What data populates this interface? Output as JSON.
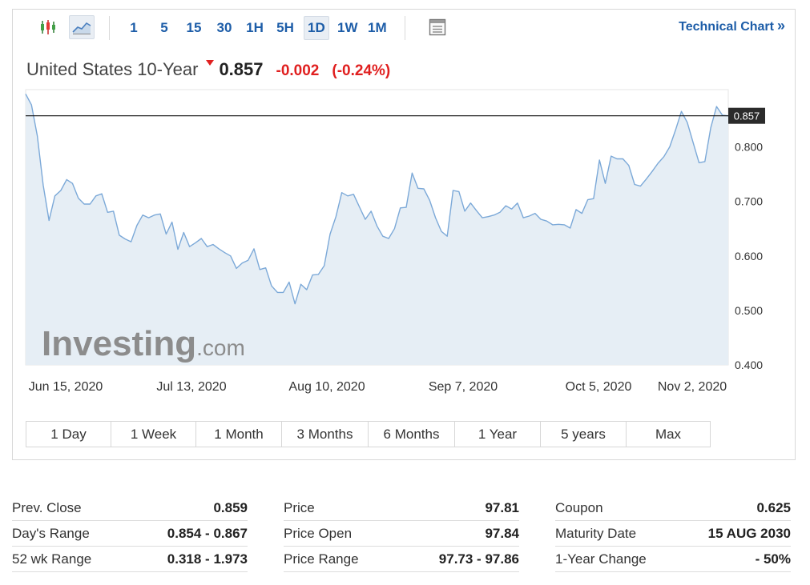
{
  "toolbar": {
    "timeframes": [
      "1",
      "5",
      "15",
      "30",
      "1H",
      "5H",
      "1D",
      "1W",
      "1M"
    ],
    "active_timeframe": "1D",
    "technical_chart_label": "Technical Chart",
    "technical_chart_arrow": "»"
  },
  "instrument": {
    "name": "United States 10-Year",
    "last": "0.857",
    "change": "-0.002",
    "change_pct": "(-0.24%)"
  },
  "watermark": {
    "brand": "Investing",
    "suffix": ".com"
  },
  "chart_data": {
    "type": "area",
    "x_tick_labels": [
      "Jun 15, 2020",
      "Jul 13, 2020",
      "Aug 10, 2020",
      "Sep 7, 2020",
      "Oct 5, 2020",
      "Nov 2, 2020"
    ],
    "y_ticks": [
      0.4,
      0.5,
      0.6,
      0.7,
      0.8
    ],
    "y_tick_labels": [
      "0.400",
      "0.500",
      "0.600",
      "0.700",
      "0.800"
    ],
    "ylim": [
      0.4,
      0.905
    ],
    "current_value_label": "0.857",
    "current_value": 0.857,
    "series": [
      {
        "values": [
          0.897,
          0.877,
          0.82,
          0.73,
          0.665,
          0.71,
          0.72,
          0.74,
          0.733,
          0.706,
          0.695,
          0.695,
          0.71,
          0.714,
          0.68,
          0.682,
          0.638,
          0.631,
          0.626,
          0.656,
          0.675,
          0.67,
          0.675,
          0.677,
          0.64,
          0.662,
          0.612,
          0.643,
          0.617,
          0.624,
          0.632,
          0.617,
          0.621,
          0.613,
          0.606,
          0.6,
          0.577,
          0.587,
          0.592,
          0.613,
          0.575,
          0.578,
          0.545,
          0.533,
          0.533,
          0.552,
          0.512,
          0.548,
          0.538,
          0.565,
          0.566,
          0.582,
          0.64,
          0.672,
          0.716,
          0.71,
          0.713,
          0.69,
          0.667,
          0.682,
          0.655,
          0.636,
          0.632,
          0.65,
          0.688,
          0.689,
          0.752,
          0.724,
          0.723,
          0.702,
          0.67,
          0.645,
          0.636,
          0.72,
          0.718,
          0.682,
          0.697,
          0.683,
          0.67,
          0.672,
          0.675,
          0.68,
          0.692,
          0.686,
          0.697,
          0.67,
          0.673,
          0.678,
          0.667,
          0.664,
          0.657,
          0.658,
          0.657,
          0.651,
          0.685,
          0.678,
          0.703,
          0.705,
          0.776,
          0.733,
          0.783,
          0.778,
          0.778,
          0.766,
          0.731,
          0.728,
          0.741,
          0.755,
          0.77,
          0.782,
          0.8,
          0.831,
          0.865,
          0.845,
          0.808,
          0.771,
          0.773,
          0.835,
          0.874,
          0.858,
          0.857
        ]
      }
    ],
    "colors": {
      "line": "#7ca9d8",
      "fill": "#e6eef5",
      "ref_line": "#111111",
      "label_bg": "#2b2b2b"
    }
  },
  "periods": [
    "1 Day",
    "1 Week",
    "1 Month",
    "3 Months",
    "6 Months",
    "1 Year",
    "5 years",
    "Max"
  ],
  "stats": {
    "col1": [
      {
        "label": "Prev. Close",
        "value": "0.859"
      },
      {
        "label": "Day's Range",
        "value": "0.854 - 0.867"
      },
      {
        "label": "52 wk Range",
        "value": "0.318 - 1.973"
      }
    ],
    "col2": [
      {
        "label": "Price",
        "value": "97.81"
      },
      {
        "label": "Price Open",
        "value": "97.84"
      },
      {
        "label": "Price Range",
        "value": "97.73 - 97.86"
      }
    ],
    "col3": [
      {
        "label": "Coupon",
        "value": "0.625"
      },
      {
        "label": "Maturity Date",
        "value": "15 AUG 2030"
      },
      {
        "label": "1-Year Change",
        "value": "- 50%"
      }
    ]
  }
}
